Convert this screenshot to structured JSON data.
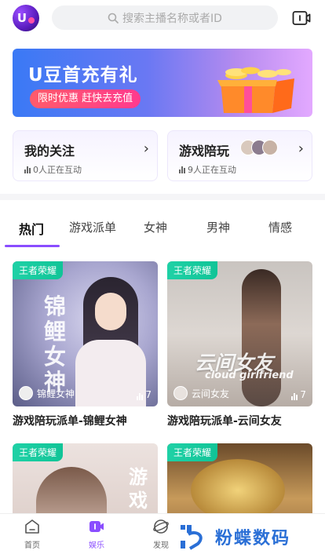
{
  "header": {
    "logo_text": "U",
    "search_placeholder": "搜索主播名称或者ID"
  },
  "banner": {
    "title": "U豆首充有礼",
    "subtitle": "限时优惠 赶快去充值"
  },
  "cards": [
    {
      "title": "我的关注",
      "status": "0人正在互动"
    },
    {
      "title": "游戏陪玩",
      "status": "9人正在互动"
    }
  ],
  "tabs": [
    {
      "label": "热门",
      "active": true
    },
    {
      "label": "游戏派单"
    },
    {
      "label": "女神"
    },
    {
      "label": "男神"
    },
    {
      "label": "情感"
    }
  ],
  "rooms": [
    {
      "tag": "王者荣耀",
      "host": "锦鲤女神",
      "count": "7",
      "title": "游戏陪玩派单-锦鲤女神",
      "overlay": "锦鲤女神"
    },
    {
      "tag": "王者荣耀",
      "host": "云间女友",
      "count": "7",
      "title": "游戏陪玩派单-云间女友",
      "overlay": "云间女友",
      "overlay_en": "cloud girlfriend"
    },
    {
      "tag": "王者荣耀",
      "overlay": "游戏"
    },
    {
      "tag": "王者荣耀"
    }
  ],
  "bottom_nav": [
    {
      "label": "首页",
      "icon": "home-icon"
    },
    {
      "label": "娱乐",
      "icon": "entertainment-icon",
      "active": true
    },
    {
      "label": "发现",
      "icon": "discover-icon"
    }
  ],
  "watermark": {
    "text": "粉蝶数码"
  },
  "colors": {
    "accent": "#8a4dff",
    "tag_green": "#1fd1a6",
    "banner_blue": "#3a79f5"
  }
}
